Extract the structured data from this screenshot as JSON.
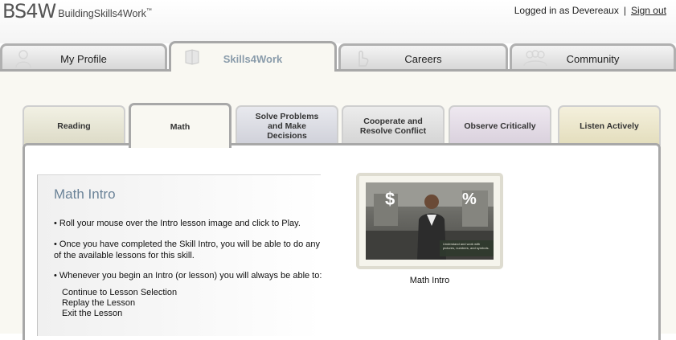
{
  "header": {
    "logo_mark": "BS4W",
    "logo_text": "BuildingSkills4Work",
    "logo_tm": "™",
    "logged_in_text": "Logged in as Devereaux",
    "separator": "|",
    "sign_out": "Sign out"
  },
  "main_tabs": [
    {
      "label": "My Profile",
      "icon": "person-icon"
    },
    {
      "label": "Skills4Work",
      "icon": "book-icon",
      "active": true
    },
    {
      "label": "Careers",
      "icon": "hand-pointer-icon"
    },
    {
      "label": "Community",
      "icon": "group-icon"
    }
  ],
  "skill_tabs": [
    {
      "label": "Reading"
    },
    {
      "label": "Math",
      "active": true
    },
    {
      "label": "Solve Problems and Make Decisions"
    },
    {
      "label": "Cooperate and Resolve Conflict"
    },
    {
      "label": "Observe Critically"
    },
    {
      "label": "Listen Actively"
    }
  ],
  "intro": {
    "title": "Math Intro",
    "p1": "• Roll your mouse over the Intro lesson image and click to Play.",
    "p2": "• Once you have completed the Skill Intro, you will be able to do any of the available lessons for this skill.",
    "p3": "• Whenever you begin an Intro (or lesson) you will always be able to:",
    "options": [
      "Continue to Lesson Selection",
      "Replay the Lesson",
      "Exit the Lesson"
    ]
  },
  "video": {
    "dollar": "$",
    "percent": "%",
    "overlay_text": "Understand and work with pictures, numbers, and symbols.",
    "caption": "Math Intro"
  },
  "colors": {
    "accent_title": "#6b8398",
    "frame_bg": "#f9f8f2",
    "tab_border": "#a8a8a8"
  }
}
